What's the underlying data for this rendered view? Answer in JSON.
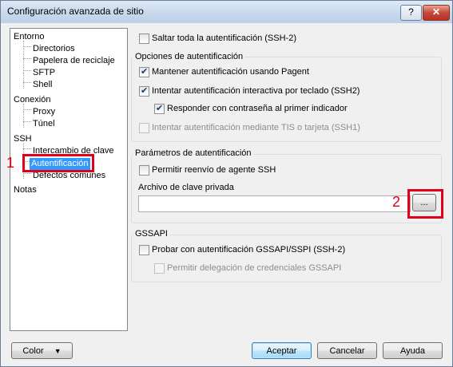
{
  "window": {
    "title": "Configuración avanzada de sitio",
    "help_glyph": "?",
    "close_glyph": "✕"
  },
  "tree": {
    "items": [
      {
        "label": "Entorno"
      },
      {
        "label": "Directorios"
      },
      {
        "label": "Papelera de reciclaje"
      },
      {
        "label": "SFTP"
      },
      {
        "label": "Shell"
      },
      {
        "label": "Conexión"
      },
      {
        "label": "Proxy"
      },
      {
        "label": "Túnel"
      },
      {
        "label": "SSH"
      },
      {
        "label": "Intercambio de clave"
      },
      {
        "label": "Autentificación",
        "selected": true
      },
      {
        "label": "Defectos comunes"
      },
      {
        "label": "Notas"
      }
    ]
  },
  "annotations": {
    "label1": "1",
    "label2": "2",
    "color": "#e0001a"
  },
  "auth": {
    "skip_all": {
      "label": "Saltar toda la autentificación (SSH-2)",
      "checked": false
    },
    "options_group": {
      "title": "Opciones de autentificación",
      "pagent": {
        "label": "Mantener autentificación usando Pagent",
        "checked": true
      },
      "keyboard": {
        "label": "Intentar autentificación interactiva por teclado (SSH2)",
        "checked": true
      },
      "respond": {
        "label": "Responder con contraseña al primer indicador",
        "checked": true
      },
      "tis": {
        "label": "Intentar autentificación mediante TIS o tarjeta (SSH1)",
        "checked": false,
        "disabled": true
      }
    },
    "params_group": {
      "title": "Parámetros de autentificación",
      "agent_fwd": {
        "label": "Permitir reenvío de agente SSH",
        "checked": false
      },
      "key_label": "Archivo de clave privada",
      "key_value": "",
      "browse": "..."
    },
    "gssapi_group": {
      "title": "GSSAPI",
      "try": {
        "label": "Probar con autentificación GSSAPI/SSPI (SSH-2)",
        "checked": false
      },
      "delegate": {
        "label": "Permitir delegación de credenciales GSSAPI",
        "checked": false,
        "disabled": true
      }
    }
  },
  "footer": {
    "color": "Color",
    "color_arrow": "▼",
    "accept": "Aceptar",
    "cancel": "Cancelar",
    "help": "Ayuda"
  }
}
